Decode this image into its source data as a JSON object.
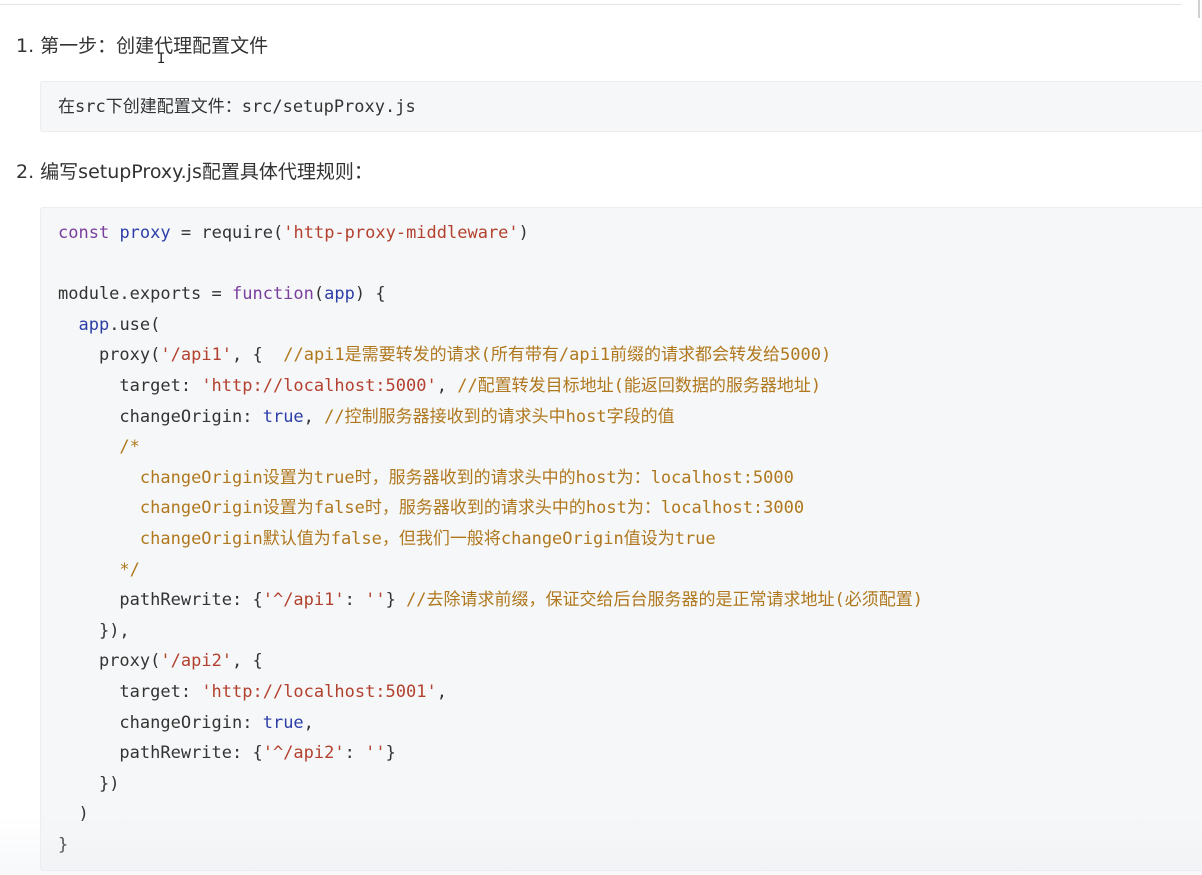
{
  "step1": {
    "label": "1. 第一步：创建代理配置文件"
  },
  "step1_code": {
    "text": "在src下创建配置文件：src/setupProxy.js"
  },
  "step2": {
    "label": "2. 编写setupProxy.js配置具体代理规则："
  },
  "code": {
    "l1_kw": "const",
    "l1_var": "proxy",
    "l1_eq": " = ",
    "l1_fn": "require",
    "l1_open": "(",
    "l1_str": "'http-proxy-middleware'",
    "l1_close": ")",
    "l3_a": "module.exports = ",
    "l3_kw": "function",
    "l3_b": "(",
    "l3_param": "app",
    "l3_c": ") {",
    "l4_obj": "app",
    "l4_b": ".use(",
    "l5_fn": "proxy",
    "l5_open": "(",
    "l5_str": "'/api1'",
    "l5_rest": ", {  ",
    "l5_cm": "//api1是需要转发的请求(所有带有/api1前缀的请求都会转发给5000)",
    "l6_key": "target: ",
    "l6_str": "'http://localhost:5000'",
    "l6_sep": ", ",
    "l6_cm": "//配置转发目标地址(能返回数据的服务器地址)",
    "l7_key": "changeOrigin: ",
    "l7_bool": "true",
    "l7_sep": ", ",
    "l7_cm": "//控制服务器接收到的请求头中host字段的值",
    "l8_cm": "/*",
    "l9_cm": "changeOrigin设置为true时，服务器收到的请求头中的host为：localhost:5000",
    "l10_cm": "changeOrigin设置为false时，服务器收到的请求头中的host为：localhost:3000",
    "l11_cm": "changeOrigin默认值为false，但我们一般将changeOrigin值设为true",
    "l12_cm": "*/",
    "l13_key": "pathRewrite: {",
    "l13_str1": "'^/api1'",
    "l13_colon": ": ",
    "l13_str2": "''",
    "l13_close": "} ",
    "l13_cm": "//去除请求前缀，保证交给后台服务器的是正常请求地址(必须配置)",
    "l14": "}),",
    "l15_fn": "proxy",
    "l15_open": "(",
    "l15_str": "'/api2'",
    "l15_rest": ", {",
    "l16_key": "target: ",
    "l16_str": "'http://localhost:5001'",
    "l16_sep": ",",
    "l17_key": "changeOrigin: ",
    "l17_bool": "true",
    "l17_sep": ",",
    "l18_key": "pathRewrite: {",
    "l18_str1": "'^/api2'",
    "l18_colon": ": ",
    "l18_str2": "''",
    "l18_close": "}",
    "l19": "})",
    "l20": ")",
    "l21": "}"
  },
  "colors": {
    "keyword": "#7a3e9d",
    "function": "#2b3ea8",
    "string": "#b3412f",
    "comment": "#b0781e",
    "code_bg": "#f6f7f8"
  }
}
